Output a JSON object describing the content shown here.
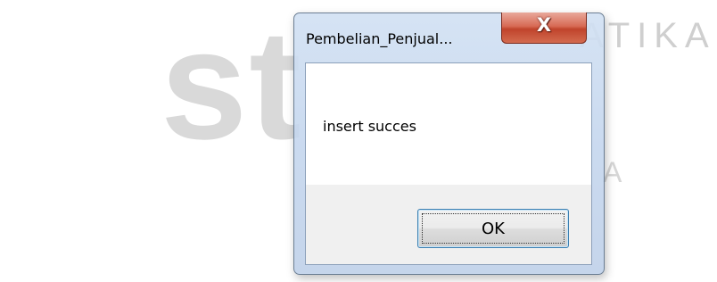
{
  "background": {
    "watermark_text": "st",
    "watermark_right": "ATIKA",
    "watermark_small": "A"
  },
  "dialog": {
    "title": "Pembelian_Penjual...",
    "close_icon": "close-icon",
    "message": "insert succes",
    "ok_label": "OK"
  },
  "colors": {
    "close_button": "#c8452e",
    "window_frame": "#c4d6ee",
    "ok_border": "#3c7fb1"
  }
}
